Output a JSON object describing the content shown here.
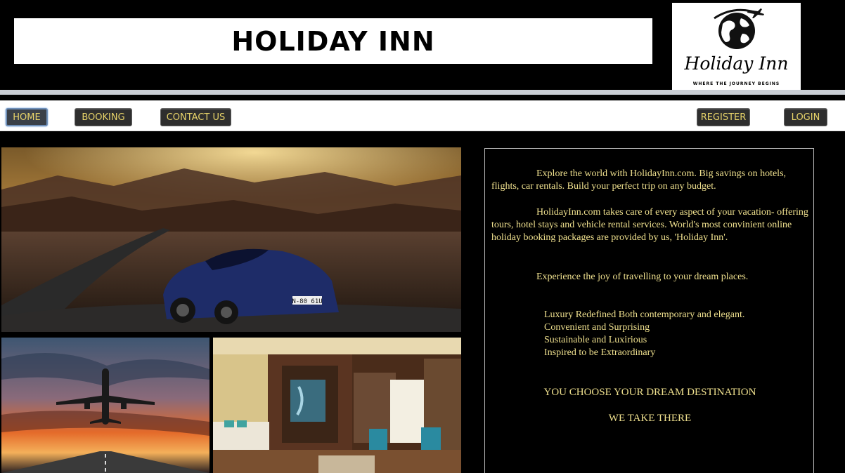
{
  "header": {
    "title": "HOLIDAY INN",
    "logo": {
      "name": "Holiday Inn",
      "tagline": "WHERE THE JOURNEY BEGINS",
      "icon": "globe-airplane-icon"
    }
  },
  "nav": {
    "left": [
      "HOME",
      "BOOKING",
      "CONTACT US"
    ],
    "right": [
      "REGISTER",
      "LOGIN"
    ],
    "active": "HOME"
  },
  "colors": {
    "accent_text": "#efe08e",
    "nav_button": "#2e2e2e",
    "background": "#000000"
  },
  "gallery": {
    "car_plate": "N-80 61U"
  },
  "info": {
    "p1": "Explore the world with HolidayInn.com. Big savings on hotels, flights, car rentals. Build your perfect trip on any budget.",
    "p2": "HolidayInn.com takes care of every aspect of your vacation- offering tours, hotel stays and vehicle rental services. World's most convinient online holiday booking packages are provided by us, 'Holiday Inn'.",
    "p3": "Experience the joy of travelling to your dream places.",
    "luxury": [
      "Luxury Redefined Both contemporary and elegant.",
      "Convenient and Surprising",
      "Sustainable and Luxirious",
      "Inspired to be Extraordinary"
    ],
    "cta1": "YOU CHOOSE YOUR DREAM DESTINATION",
    "cta2": "WE TAKE THERE"
  }
}
